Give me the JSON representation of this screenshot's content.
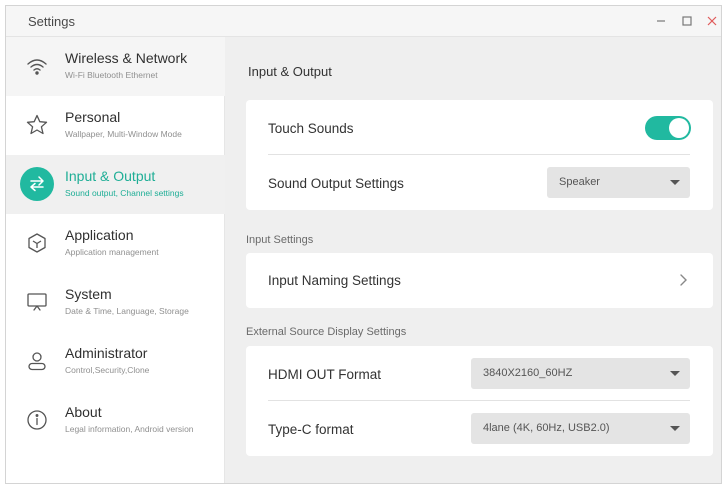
{
  "window": {
    "title": "Settings",
    "controls": [
      "minimize-icon",
      "maximize-icon",
      "close-icon"
    ]
  },
  "sidebar": {
    "items": [
      {
        "label": "Wireless & Network",
        "sub": "Wi-Fi Bluetooth Ethernet",
        "icon": "wifi-icon"
      },
      {
        "label": "Personal",
        "sub": "Wallpaper, Multi-Window Mode",
        "icon": "star-icon"
      },
      {
        "label": "Input & Output",
        "sub": "Sound output, Channel settings",
        "icon": "swap-arrows-icon"
      },
      {
        "label": "Application",
        "sub": "Application management",
        "icon": "cube-icon"
      },
      {
        "label": "System",
        "sub": "Date & Time, Language, Storage",
        "icon": "monitor-icon"
      },
      {
        "label": "Administrator",
        "sub": "Control,Security,Clone",
        "icon": "user-icon"
      },
      {
        "label": "About",
        "sub": "Legal information, Android version",
        "icon": "info-icon"
      }
    ]
  },
  "main": {
    "title": "Input & Output",
    "sound": {
      "touch_sounds_label": "Touch Sounds",
      "touch_sounds_on": true,
      "sound_output_label": "Sound Output Settings",
      "sound_output_value": "Speaker"
    },
    "input_settings": {
      "section_label": "Input Settings",
      "input_naming_label": "Input Naming Settings"
    },
    "external_display": {
      "section_label": "External Source Display Settings",
      "hdmi_label": "HDMI OUT Format",
      "hdmi_value": "3840X2160_60HZ",
      "typec_label": "Type-C format",
      "typec_value": "4lane (4K, 60Hz, USB2.0)"
    }
  },
  "colors": {
    "accent": "#21b9a0",
    "close": "#e05a5a"
  }
}
